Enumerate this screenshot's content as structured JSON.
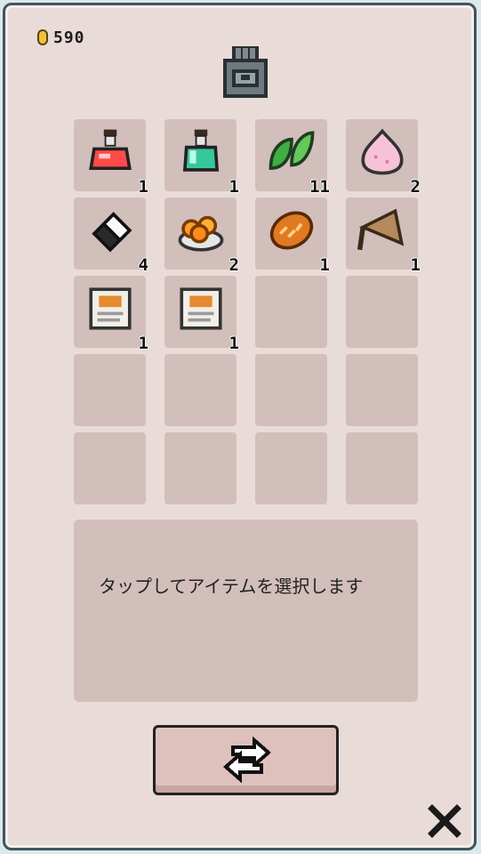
{
  "header": {
    "coins": "590",
    "coin_icon": "gold-coin-icon",
    "bag_icon": "backpack-icon"
  },
  "inventory": {
    "slots": [
      {
        "item": "red-potion-icon",
        "count": "1"
      },
      {
        "item": "green-potion-icon",
        "count": "1"
      },
      {
        "item": "herb-leaves-icon",
        "count": "11"
      },
      {
        "item": "pink-slime-icon",
        "count": "2"
      },
      {
        "item": "rice-ball-icon",
        "count": "4"
      },
      {
        "item": "fruit-bowl-icon",
        "count": "2"
      },
      {
        "item": "bread-icon",
        "count": "1"
      },
      {
        "item": "paper-fan-icon",
        "count": "1"
      },
      {
        "item": "recipe-card-icon",
        "count": "1"
      },
      {
        "item": "recipe-card-icon",
        "count": "1"
      },
      {
        "item": "",
        "count": ""
      },
      {
        "item": "",
        "count": ""
      },
      {
        "item": "",
        "count": ""
      },
      {
        "item": "",
        "count": ""
      },
      {
        "item": "",
        "count": ""
      },
      {
        "item": "",
        "count": ""
      },
      {
        "item": "",
        "count": ""
      },
      {
        "item": "",
        "count": ""
      },
      {
        "item": "",
        "count": ""
      },
      {
        "item": "",
        "count": ""
      }
    ]
  },
  "description": {
    "text": "タップしてアイテムを選択します"
  },
  "footer": {
    "swap_icon": "swap-arrows-icon",
    "close_icon": "close-icon"
  },
  "colors": {
    "panel": "#e9dbd8",
    "slot": "#d2bebb",
    "border": "#3f5560",
    "coin": "#f2c23a"
  }
}
